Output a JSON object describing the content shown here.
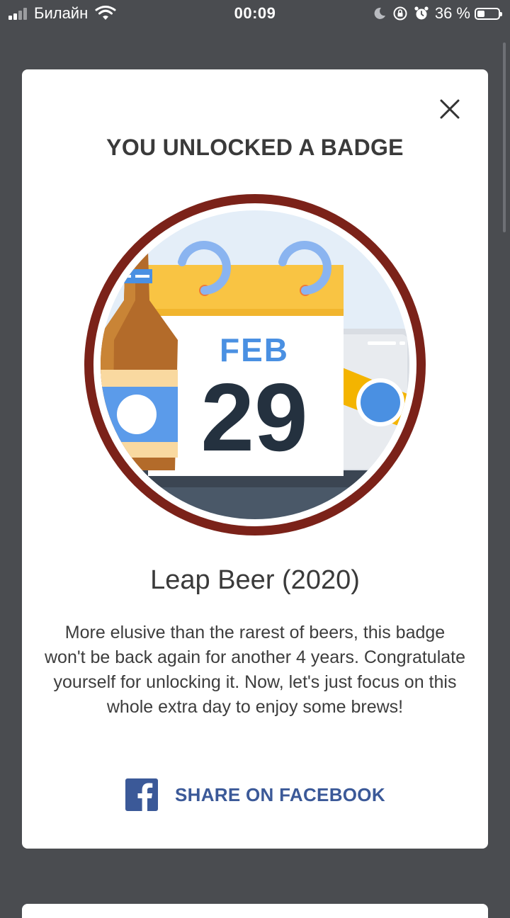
{
  "status_bar": {
    "carrier": "Билайн",
    "time": "00:09",
    "battery": "36 %",
    "battery_level": 0.36
  },
  "modal": {
    "title": "YOU UNLOCKED A BADGE",
    "badge": {
      "calendar_month": "FEB",
      "calendar_day": "29"
    },
    "badge_name": "Leap Beer (2020)",
    "description": "More elusive than the rarest of beers, this badge won't be back again for another 4 years. Congratulate yourself for unlocking it. Now, let's just focus on this whole extra day to enjoy some brews!",
    "share_label": "SHARE ON FACEBOOK"
  },
  "icons": [
    "cellular-signal-icon",
    "wifi-icon",
    "moon-icon",
    "orientation-lock-icon",
    "alarm-icon",
    "battery-icon",
    "close-icon",
    "facebook-icon"
  ],
  "colors": {
    "background": "#4a4c50",
    "badge_ring": "#7b2219",
    "calendar_header": "#f9c443",
    "facebook_blue": "#3b5998",
    "feb_blue": "#4a90e2",
    "day_dark": "#24313f"
  }
}
